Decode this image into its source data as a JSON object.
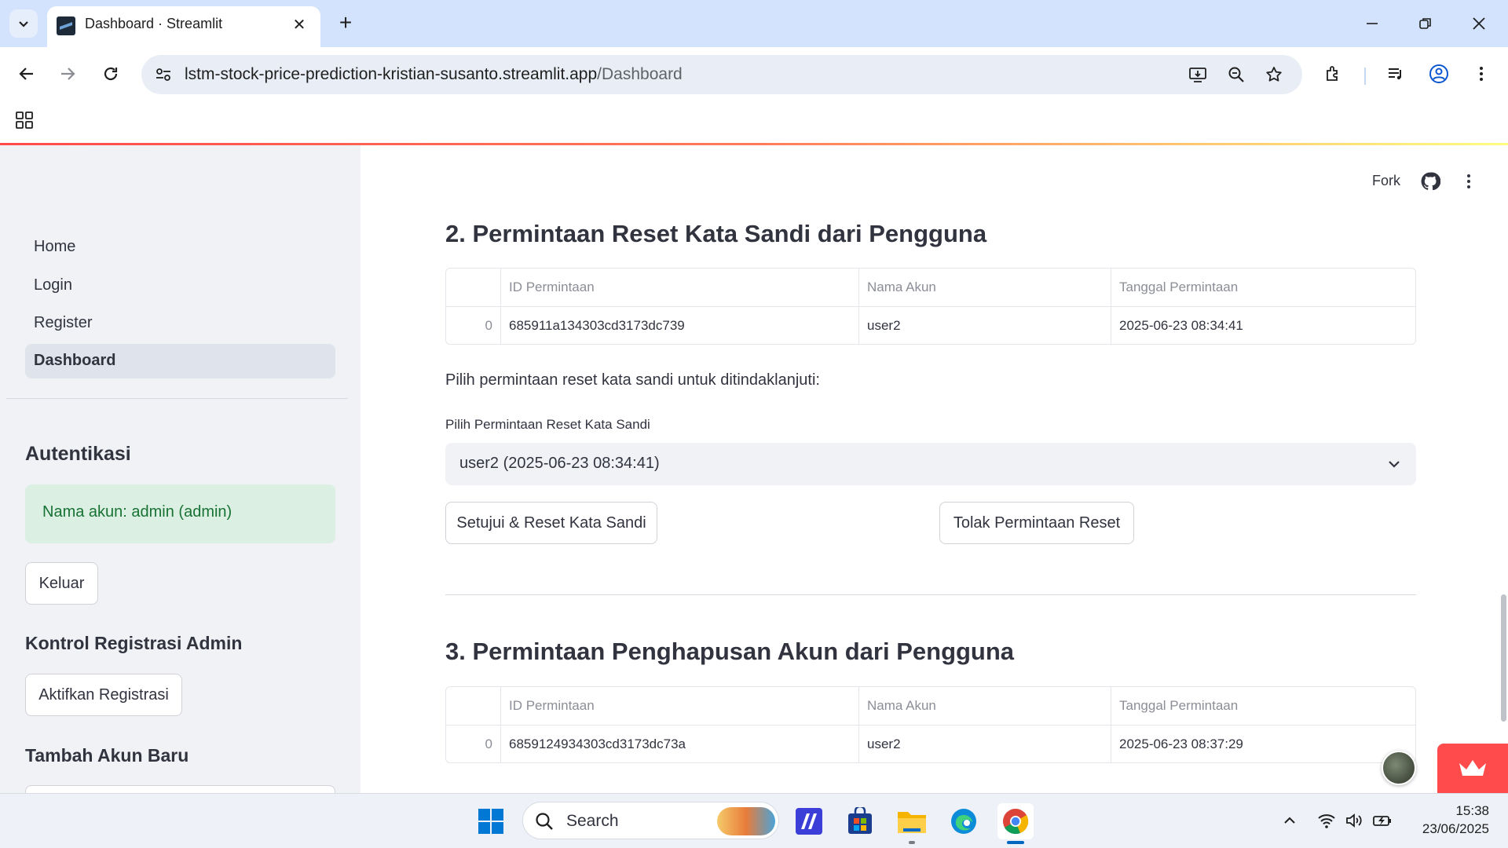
{
  "browser": {
    "tab_title": "Dashboard · Streamlit",
    "url_host": "lstm-stock-price-prediction-kristian-susanto.streamlit.app",
    "url_path": "/Dashboard"
  },
  "sidebar": {
    "nav_items": [
      {
        "label": "Home",
        "active": false
      },
      {
        "label": "Login",
        "active": false
      },
      {
        "label": "Register",
        "active": false
      },
      {
        "label": "Dashboard",
        "active": true
      }
    ],
    "auth_heading": "Autentikasi",
    "account_status": "Nama akun: admin (admin)",
    "logout_label": "Keluar",
    "registration_heading": "Kontrol Registrasi Admin",
    "enable_registration_label": "Aktifkan Registrasi",
    "add_account_heading": "Tambah Akun Baru"
  },
  "header": {
    "fork_label": "Fork"
  },
  "reset_section": {
    "title": "2. Permintaan Reset Kata Sandi dari Pengguna",
    "columns": [
      "",
      "ID Permintaan",
      "Nama Akun",
      "Tanggal Permintaan"
    ],
    "rows": [
      {
        "index": "0",
        "id": "685911a134303cd3173dc739",
        "account": "user2",
        "date": "2025-06-23 08:34:41"
      }
    ],
    "instruction": "Pilih permintaan reset kata sandi untuk ditindaklanjuti:",
    "select_label": "Pilih Permintaan Reset Kata Sandi",
    "select_value": "user2 (2025-06-23 08:34:41)",
    "approve_label": "Setujui & Reset Kata Sandi",
    "reject_label": "Tolak Permintaan Reset"
  },
  "delete_section": {
    "title": "3. Permintaan Penghapusan Akun dari Pengguna",
    "columns": [
      "",
      "ID Permintaan",
      "Nama Akun",
      "Tanggal Permintaan"
    ],
    "rows": [
      {
        "index": "0",
        "id": "6859124934303cd3173dc73a",
        "account": "user2",
        "date": "2025-06-23 08:37:29"
      }
    ]
  },
  "taskbar": {
    "search_placeholder": "Search",
    "time": "15:38",
    "date": "23/06/2025"
  },
  "colors": {
    "accent": "#ff4b4b",
    "success_bg": "#dbefe3",
    "success_text": "#177233",
    "sidebar_bg": "#f0f2f6",
    "browser_tabbar": "#d3e3fd"
  }
}
